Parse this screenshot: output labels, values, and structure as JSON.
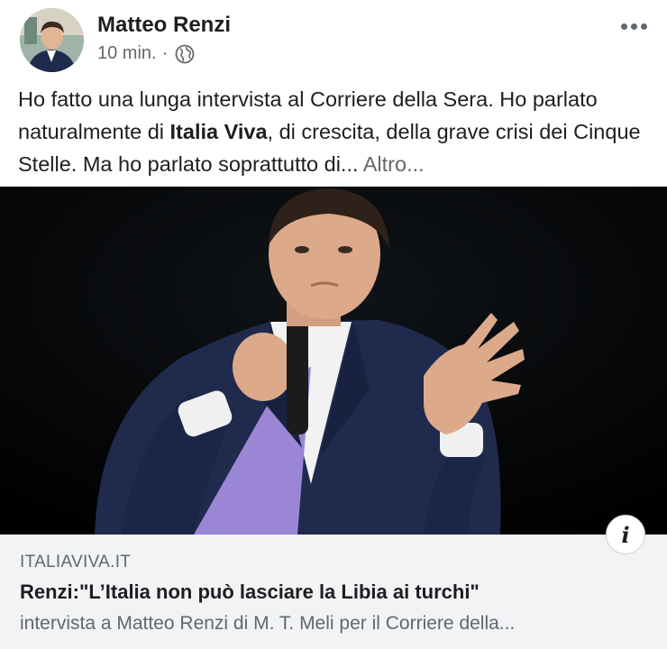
{
  "post": {
    "author": "Matteo Renzi",
    "time": "10 min.",
    "separator": "·",
    "privacy_icon": "globe-icon",
    "menu_icon": "more-options-icon",
    "text_part1": "Ho fatto una lunga intervista al Corriere della Sera. Ho parlato naturalmente di ",
    "text_bold": "Italia Viva",
    "text_part2": ", di crescita, della grave crisi dei Cinque Stelle. Ma ho parlato soprattutto di... ",
    "see_more": "Altro..."
  },
  "link": {
    "domain": "ITALIAVIVA.IT",
    "title": "Renzi:\"L’Italia non può lasciare la Libia ai turchi\"",
    "description": "intervista a Matteo Renzi di M. T. Meli per il Corriere della...",
    "info_icon": "i"
  },
  "colors": {
    "secondary_text": "#65676b",
    "card_background": "#f2f3f5",
    "suit": "#1f2a4d",
    "tie": "#9b86d6"
  }
}
